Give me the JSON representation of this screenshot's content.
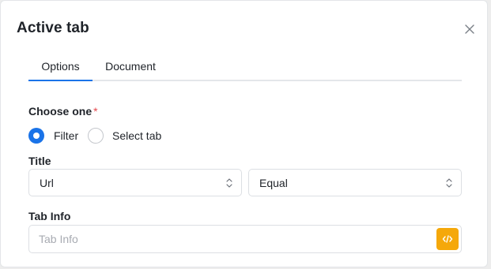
{
  "dialog": {
    "title": "Active tab"
  },
  "tabs": [
    {
      "label": "Options",
      "active": true
    },
    {
      "label": "Document",
      "active": false
    }
  ],
  "choose_one": {
    "label": "Choose one",
    "required_mark": "*",
    "options": [
      {
        "label": "Filter",
        "checked": true
      },
      {
        "label": "Select tab",
        "checked": false
      }
    ]
  },
  "title_field": {
    "label": "Title",
    "property_select": {
      "value": "Url"
    },
    "operator_select": {
      "value": "Equal"
    }
  },
  "tab_info": {
    "label": "Tab Info",
    "value": "",
    "placeholder": "Tab Info"
  },
  "icons": {
    "close": "close-icon",
    "chevron": "chevron-up-down-icon",
    "code": "code-icon"
  },
  "colors": {
    "accent": "#1a73e8",
    "required": "#e5484d",
    "code_button": "#f5a80a"
  }
}
